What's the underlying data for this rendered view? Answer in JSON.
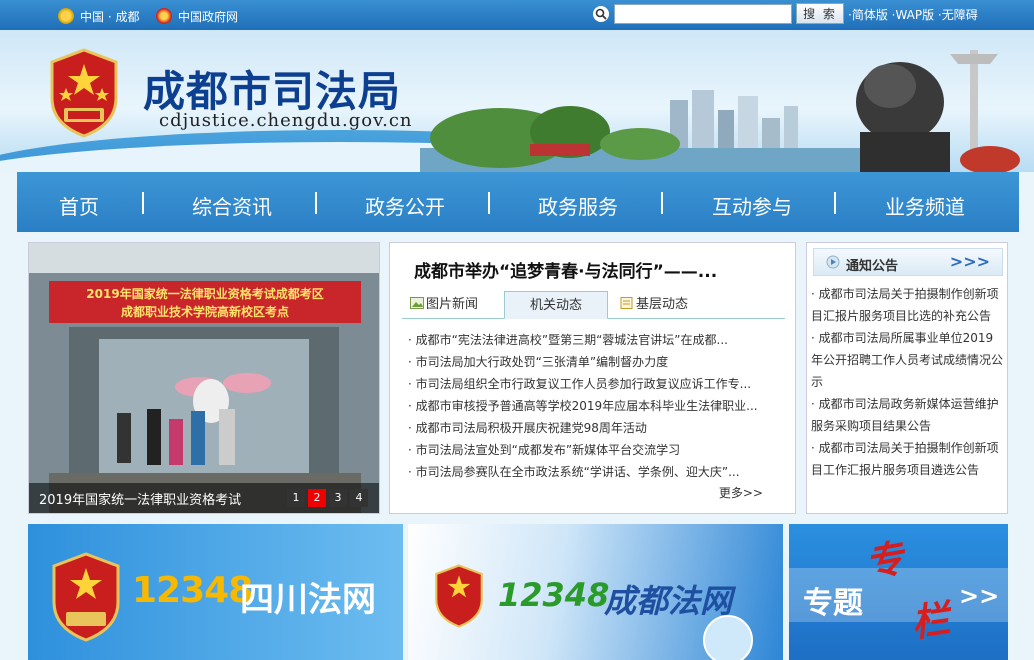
{
  "topbar": {
    "links_left": [
      "中国 · 成都",
      "中国政府网"
    ],
    "search": {
      "placeholder": "",
      "button": "搜 索"
    },
    "links_right": "·简体版 ·WAP版 ·无障碍"
  },
  "header": {
    "title": "成都市司法局",
    "url": "cdjustice.chengdu.gov.cn"
  },
  "nav": {
    "items": [
      "首页",
      "综合资讯",
      "政务公开",
      "政务服务",
      "互动参与",
      "业务频道"
    ]
  },
  "slideshow": {
    "banner_line1": "2019年国家统一法律职业资格考试成都考区",
    "banner_line2": "成都职业技术学院高新校区考点",
    "caption": "2019年国家统一法律职业资格考试",
    "pages": [
      "1",
      "2",
      "3",
      "4"
    ],
    "active_page": "2"
  },
  "news": {
    "headline": "成都市举办“追梦青春·与法同行”——...",
    "tabs": [
      "图片新闻",
      "机关动态",
      "基层动态"
    ],
    "active_tab": "机关动态",
    "items": [
      "成都市“宪法法律进高校”暨第三期“蓉城法官讲坛”在成都...",
      "市司法局加大行政处罚“三张清单”编制督办力度",
      "市司法局组织全市行政复议工作人员参加行政复议应诉工作专...",
      "成都市审核授予普通高等学校2019年应届本科毕业生法律职业...",
      "成都市司法局积极开展庆祝建党98周年活动",
      "市司法局法宣处到“成都发布”新媒体平台交流学习",
      "市司法局参赛队在全市政法系统“学讲话、学条例、迎大庆”..."
    ],
    "more": "更多>>"
  },
  "notice": {
    "title": "通知公告",
    "arrows": ">>>",
    "items": [
      "成都市司法局关于拍摄制作创新项目汇报片服务项目比选的补充公告",
      "成都市司法局所属事业单位2019年公开招聘工作人员考试成绩情况公示",
      "成都市司法局政务新媒体运营维护服务采购项目结果公告",
      "成都市司法局关于拍摄制作创新项目工作汇报片服务项目遴选公告"
    ]
  },
  "bottom": {
    "b1_num": "12348",
    "b1_text": "四川法网",
    "b2_num": "12348",
    "b2_text": "成都法网",
    "b3_text1": "专题",
    "b3_text2": "专",
    "b3_text3": "栏",
    "b3_arrows": ">>"
  },
  "colors": {
    "nav": "#2a7fc4",
    "title": "#0c3f8f",
    "active_page": "#e00000"
  }
}
